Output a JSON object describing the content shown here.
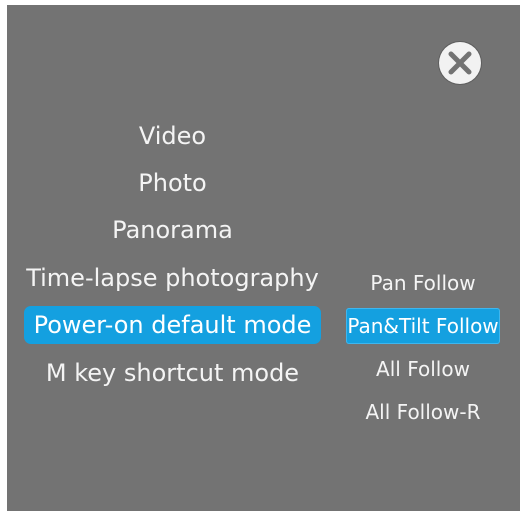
{
  "close": {
    "icon": "close-icon"
  },
  "main_menu": {
    "items": [
      {
        "label": "Video"
      },
      {
        "label": "Photo"
      },
      {
        "label": "Panorama"
      },
      {
        "label": "Time-lapse photography"
      },
      {
        "label": "Power-on default mode",
        "selected": true
      },
      {
        "label": "M key shortcut mode"
      }
    ]
  },
  "sub_menu": {
    "items": [
      {
        "label": "Pan Follow"
      },
      {
        "label": "Pan&Tilt Follow",
        "selected": true
      },
      {
        "label": "All Follow"
      },
      {
        "label": "All Follow-R"
      }
    ]
  },
  "colors": {
    "panel_bg": "#737373",
    "highlight": "#14a0e0",
    "text": "#f4f4f4"
  }
}
